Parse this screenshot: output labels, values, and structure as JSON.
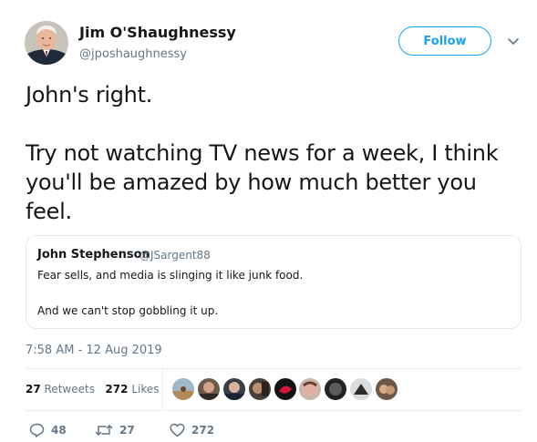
{
  "author": {
    "name": "Jim O'Shaughnessy",
    "handle": "@jposhaughnessy",
    "avatar": "profile-photo"
  },
  "follow_label": "Follow",
  "menu_icon": "chevron-down-icon",
  "tweet_text": "John's right.\n\nTry not watching TV news for a week, I think you'll be amazed by how much better you feel.",
  "quoted_tweet": {
    "name": "John Stephenson",
    "handle": "@JSargent88",
    "line1": "Fear sells, and media is slinging it like junk food.",
    "line2": "And we can't stop gobbling it up."
  },
  "timestamp": "7:58 AM - 12 Aug 2019",
  "stats": {
    "retweets_count": "27",
    "retweets_label": "Retweets",
    "likes_count": "272",
    "likes_label": "Likes"
  },
  "liker_avatars": [
    "avatar-1",
    "avatar-2",
    "avatar-3",
    "avatar-4",
    "avatar-5",
    "avatar-6",
    "avatar-7",
    "avatar-8",
    "avatar-9"
  ],
  "actions": {
    "reply_count": "48",
    "retweet_count": "27",
    "like_count": "272"
  },
  "colors": {
    "accent": "#1da1f2",
    "secondary_text": "#657786",
    "primary_text": "#14171a",
    "border": "#e1e8ed"
  }
}
